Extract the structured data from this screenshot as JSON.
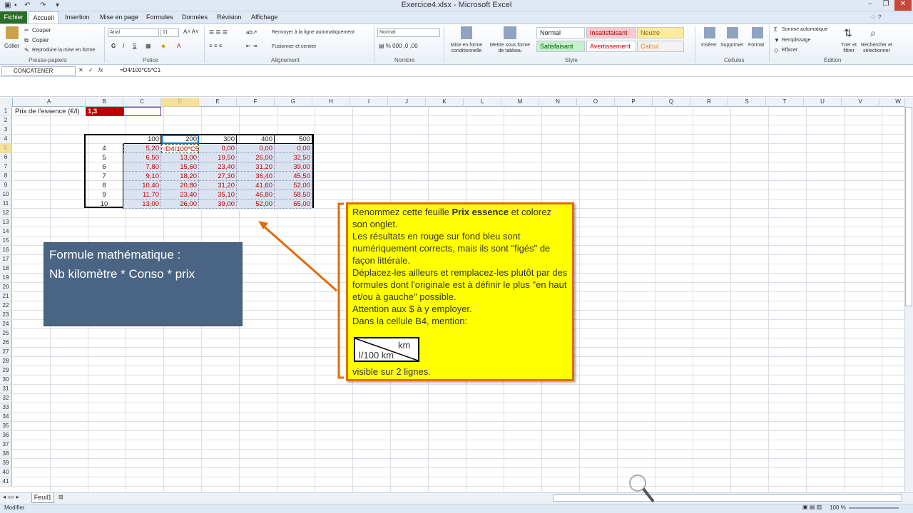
{
  "window": {
    "title": "Exercice4.xlsx - Microsoft Excel"
  },
  "tabs": [
    "Fichier",
    "Accueil",
    "Insertion",
    "Mise en page",
    "Formules",
    "Données",
    "Révision",
    "Affichage"
  ],
  "ribbon": {
    "clipboard": {
      "paste": "Coller",
      "cut": "Couper",
      "copy": "Copier",
      "format_painter": "Reproduire la mise en forme",
      "group": "Presse-papiers"
    },
    "font": {
      "name": "Arial",
      "size": "11",
      "bold": "G",
      "italic": "I",
      "underline": "S",
      "group": "Police"
    },
    "alignment": {
      "wrap": "Renvoyer à la ligne automatiquement",
      "merge": "Fusionner et centrer",
      "group": "Alignement"
    },
    "number": {
      "format": "Normal",
      "group": "Nombre"
    },
    "styles": {
      "cond_format": "Mise en forme conditionnelle",
      "as_table": "Mettre sous forme de tableau",
      "normal": "Normal",
      "bad": "Insatisfaisant",
      "neutral": "Neutre",
      "good": "Satisfaisant",
      "warning": "Avertissement",
      "calc": "Calcul",
      "group": "Style"
    },
    "cells": {
      "insert": "Insérer",
      "delete": "Supprimer",
      "format": "Format",
      "group": "Cellules"
    },
    "editing": {
      "autosum": "Somme automatique",
      "fill": "Remplissage",
      "clear": "Effacer",
      "sort": "Trier et filtrer",
      "find": "Rechercher et sélectionner",
      "group": "Édition"
    }
  },
  "formula_bar": {
    "name_box": "CONCATENER",
    "formula": "=D4/100*C5*C1"
  },
  "columns": [
    "A",
    "B",
    "C",
    "D",
    "E",
    "F",
    "G",
    "H",
    "I",
    "J",
    "K",
    "L",
    "M",
    "N",
    "O",
    "P",
    "Q",
    "R",
    "S",
    "T",
    "U",
    "V",
    "W"
  ],
  "rows": [
    "1",
    "2",
    "3",
    "4",
    "5",
    "6",
    "7",
    "8",
    "9",
    "10",
    "11",
    "12",
    "13",
    "14",
    "15",
    "16",
    "17",
    "18",
    "19",
    "20",
    "21",
    "22",
    "23",
    "24",
    "25",
    "26",
    "27",
    "28",
    "29",
    "30",
    "31",
    "32",
    "33",
    "34",
    "35",
    "36",
    "37",
    "38",
    "39",
    "40",
    "41"
  ],
  "sheet": {
    "a1": "Prix de l'essence (€/l)",
    "b1": "1,3",
    "header_row": [
      "100",
      "200",
      "300",
      "400",
      "500"
    ],
    "row_labels": [
      "4",
      "5",
      "6",
      "7",
      "8",
      "9",
      "10"
    ],
    "values": [
      [
        "5,20",
        "=D4/100*C5",
        "0,00",
        "0,00",
        "0,00"
      ],
      [
        "6,50",
        "13,00",
        "19,50",
        "26,00",
        "32,50"
      ],
      [
        "7,80",
        "15,60",
        "23,40",
        "31,20",
        "39,00"
      ],
      [
        "9,10",
        "18,20",
        "27,30",
        "36,40",
        "45,50"
      ],
      [
        "10,40",
        "20,80",
        "31,20",
        "41,60",
        "52,00"
      ],
      [
        "11,70",
        "23,40",
        "35,10",
        "46,80",
        "58,50"
      ],
      [
        "13,00",
        "26,00",
        "39,00",
        "52,00",
        "65,00"
      ]
    ]
  },
  "note": {
    "line1_pre": "Renommez cette feuille ",
    "line1_bold": "Prix essence",
    "line1_post": " et colorez son onglet.",
    "para2": "Les résultats en rouge sur fond bleu sont numériquement corrects, mais ils sont \"figés\" de façon littérale.",
    "para3": "Déplacez-les ailleurs et remplacez-les plutôt par des formules dont l'originale est à définir le plus \"en haut et/ou à gauche\" possible.",
    "para4": "Attention aux $ à y employer.",
    "para5": "Dans la cellule B4, mention:",
    "km": "km",
    "l100": "l/100 km",
    "para6": "visible sur 2 lignes."
  },
  "formula_box": {
    "line1": "Formule mathématique :",
    "line2": "Nb kilomètre * Conso * prix"
  },
  "sheet_tab": "Feuil1",
  "status": {
    "mode": "Modifier",
    "zoom": "100 %"
  },
  "colors": {
    "accent": "#e36c09",
    "note_bg": "#ffff00",
    "result_red": "#c00000",
    "result_bg": "#dbe3f1",
    "box_blue": "#4a6583",
    "b1_fill": "#c00000"
  }
}
